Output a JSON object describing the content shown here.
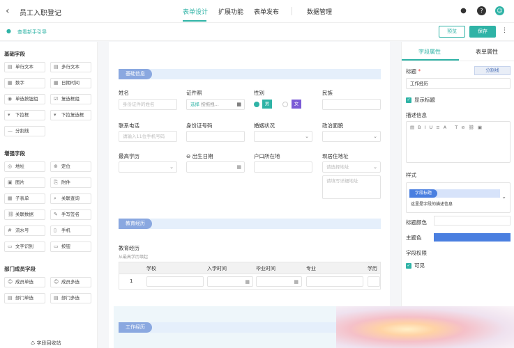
{
  "header": {
    "back_glyph": "‹",
    "title": "员工入职登记",
    "tabs": [
      {
        "label": "表单设计",
        "active": true
      },
      {
        "label": "扩展功能"
      },
      {
        "label": "表单发布"
      },
      {
        "label": "数据管理"
      }
    ]
  },
  "subbar": {
    "guide": "查看新手引导",
    "preview": "预览",
    "save": "保存"
  },
  "left": {
    "groups": [
      {
        "title": "基础字段",
        "items": [
          "单行文本",
          "多行文本",
          "数字",
          "日期时间",
          "单选按钮组",
          "复选框组",
          "下拉框",
          "下拉复选框",
          "分割线"
        ]
      },
      {
        "title": "增强字段",
        "items": [
          "地址",
          "定位",
          "图片",
          "附件",
          "子表单",
          "关联查询",
          "关联数据",
          "手写签名",
          "流水号",
          "手机",
          "文字识别",
          "按钮"
        ]
      },
      {
        "title": "部门成员字段",
        "items": [
          "成员单选",
          "成员多选",
          "部门单选",
          "部门多选"
        ]
      }
    ],
    "recycle": "字段回收站"
  },
  "form": {
    "sections": [
      "基础信息",
      "教育经历",
      "工作经历"
    ],
    "fields": {
      "name": {
        "label": "姓名",
        "placeholder": "身份证件的姓名"
      },
      "idtype": {
        "label": "证件照",
        "choose": "选择",
        "hint": "按拖拽..."
      },
      "gender": {
        "label": "性别",
        "opt1": "男",
        "opt2": "女"
      },
      "nation": {
        "label": "民族"
      },
      "phone": {
        "label": "联系电话",
        "placeholder": "请输入11位手机号码"
      },
      "idno": {
        "label": "身份证号码"
      },
      "marriage": {
        "label": "婚姻状况"
      },
      "politics": {
        "label": "政治面貌"
      },
      "edu": {
        "label": "最高学历"
      },
      "birthday": {
        "label": "出生日期"
      },
      "hukou": {
        "label": "户口所在地"
      },
      "address": {
        "label": "现居住地址",
        "select": "请选择地址",
        "detail": "请填写详细地址"
      }
    },
    "edu_table": {
      "title": "教育经历",
      "hint": "从最高学历填起",
      "columns": [
        "学校",
        "入学时间",
        "毕业时间",
        "专业",
        "学历"
      ],
      "row_no": "1"
    }
  },
  "panel": {
    "tabs": [
      "字段属性",
      "表单属性"
    ],
    "title_label": "标题",
    "required": "*",
    "divider_btn": "分割线",
    "title_value": "工作经历",
    "show_title": "显示标题",
    "desc_label": "描述信息",
    "style_label": "样式",
    "style_preview_tag": "字段标题",
    "style_preview_desc": "这里是字段的描述信息",
    "title_color": "标题颜色",
    "theme_color": "主题色",
    "theme_hex": "#4a7fe0",
    "perm_label": "字段权限",
    "visible": "可见"
  }
}
